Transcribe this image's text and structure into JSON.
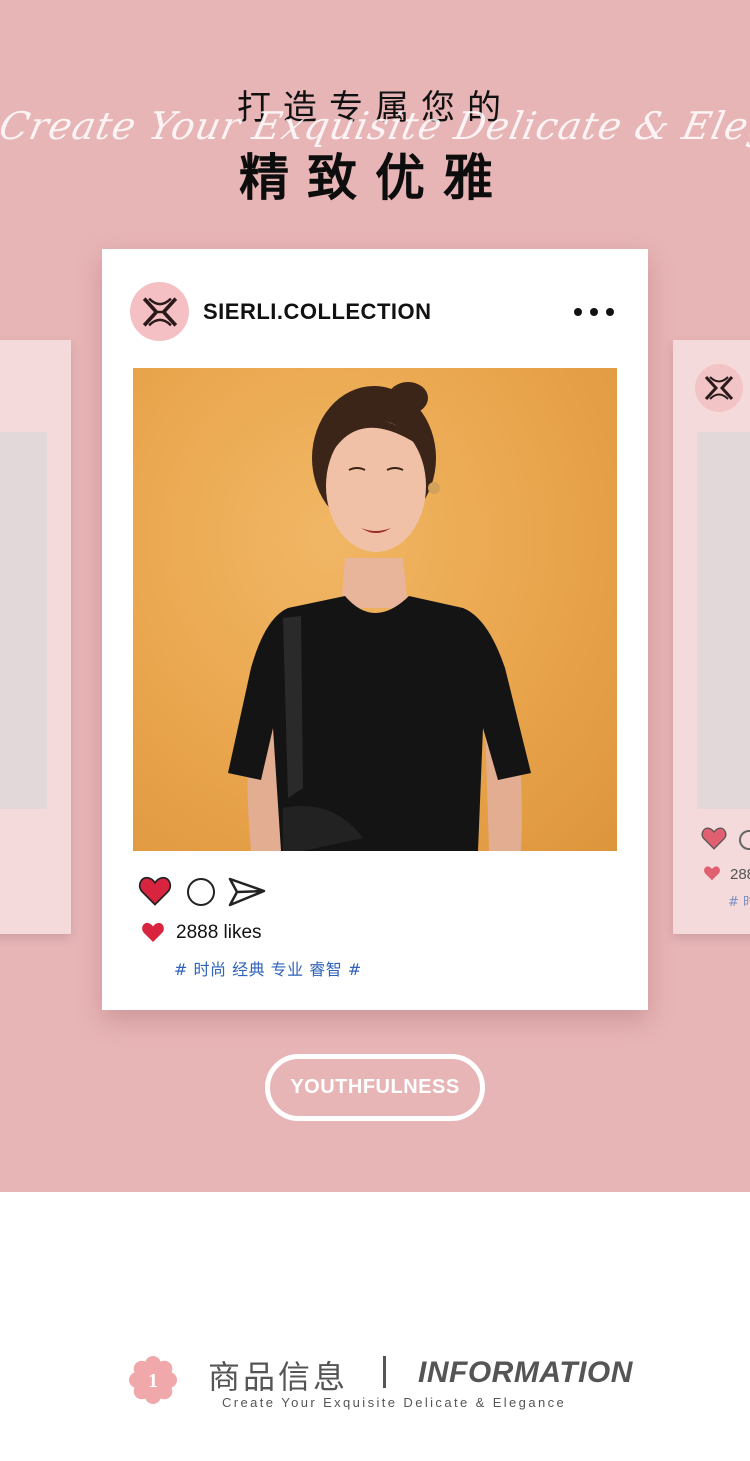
{
  "banner": {
    "heading_top": "打造专属您的",
    "script_text": "Create Your Exquisite Delicate & Elegance",
    "heading_main": "精致优雅",
    "background_color": "#e8b5b7"
  },
  "post": {
    "account_name": "SIERLI.COLLECTION",
    "more_icon": "more-dots-icon",
    "likes": "2888 likes",
    "tags": "# 时尚 经典 专业 睿智 #",
    "heart_color": "#d8243f",
    "tag_color": "#2f63b8"
  },
  "side_card_right": {
    "likes_partial": "288",
    "tags_partial": "# 时"
  },
  "badge": {
    "label": "YOUTHFULNESS"
  },
  "info_section": {
    "number": "1",
    "title_cn": "商品信息",
    "title_en": "INFORMATION",
    "subtitle": "Create Your Exquisite Delicate & Elegance"
  }
}
